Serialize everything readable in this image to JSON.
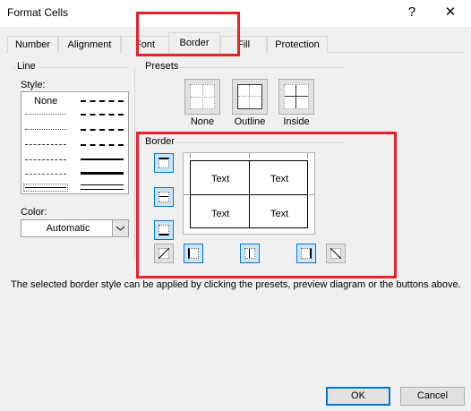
{
  "window": {
    "title": "Format Cells",
    "help_label": "?",
    "close_label": "✕"
  },
  "tabs": [
    {
      "label": "Number"
    },
    {
      "label": "Alignment"
    },
    {
      "label": "Font"
    },
    {
      "label": "Border",
      "active": true
    },
    {
      "label": "Fill"
    },
    {
      "label": "Protection"
    }
  ],
  "line": {
    "group_label": "Line",
    "style_label": "Style:",
    "style_none": "None",
    "color_label": "Color:",
    "color_value": "Automatic"
  },
  "presets": {
    "group_label": "Presets",
    "none_label": "None",
    "outline_label": "Outline",
    "inside_label": "Inside"
  },
  "border": {
    "group_label": "Border",
    "cell_texts": [
      "Text",
      "Text",
      "Text",
      "Text"
    ]
  },
  "description": "The selected border style can be applied by clicking the presets, preview diagram or the buttons above.",
  "buttons": {
    "ok": "OK",
    "cancel": "Cancel"
  },
  "colors": {
    "highlight_red": "#e8202a",
    "accent_blue": "#0078d7"
  }
}
